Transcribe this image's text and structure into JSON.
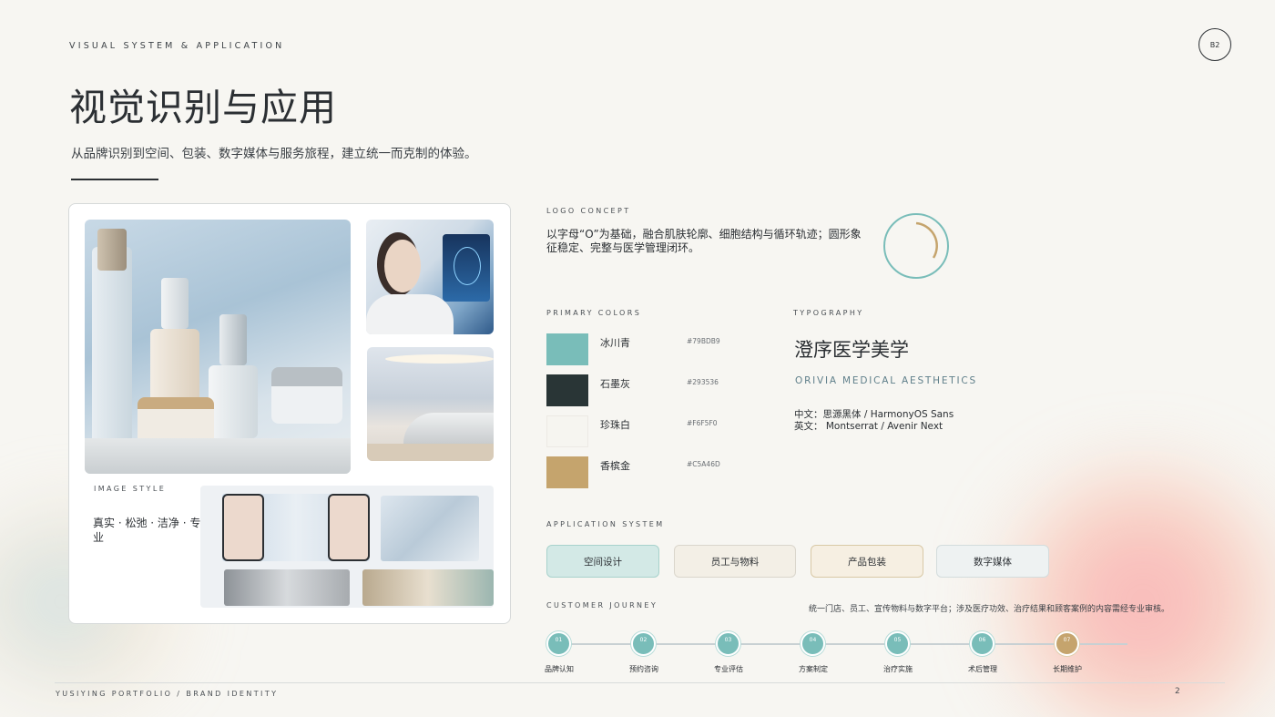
{
  "header": {
    "kicker": "VISUAL SYSTEM & APPLICATION",
    "badge": "B2",
    "title": "视觉识别与应用",
    "subtitle": "从品牌识别到空间、包装、数字媒体与服务旅程，建立统一而克制的体验。"
  },
  "image_panel": {
    "label": "IMAGE STYLE",
    "style_text": "真实 · 松弛 · 洁净 · 专业"
  },
  "logo_concept": {
    "label": "LOGO CONCEPT",
    "text": "以字母“O”为基础，融合肌肤轮廓、细胞结构与循环轨迹；圆形象征稳定、完整与医学管理闭环。",
    "ring_color": "#79BDB9",
    "arc_color": "#C5A46D"
  },
  "colors": {
    "label": "PRIMARY COLORS",
    "items": [
      {
        "name": "冰川青",
        "hex": "#79BDB9"
      },
      {
        "name": "石墨灰",
        "hex": "#293536"
      },
      {
        "name": "珍珠白",
        "hex": "#F6F5F0"
      },
      {
        "name": "香槟金",
        "hex": "#C5A46D"
      }
    ]
  },
  "typography": {
    "label": "TYPOGRAPHY",
    "cn_name": "澄序医学美学",
    "en_name": "ORIVIA MEDICAL AESTHETICS",
    "cn_font": "中文：思源黑体  / HarmonyOS Sans",
    "en_font": "英文：  Montserrat / Avenir Next"
  },
  "application": {
    "label": "APPLICATION SYSTEM",
    "buttons": [
      "空间设计",
      "员工与物料",
      "产品包装",
      "数字媒体"
    ]
  },
  "journey": {
    "label": "CUSTOMER JOURNEY",
    "note": "统一门店、员工、宣传物料与数字平台；涉及医疗功效、治疗结果和顾客案例的内容需经专业审核。",
    "steps": [
      {
        "num": "01",
        "label": "品牌认知"
      },
      {
        "num": "02",
        "label": "预约咨询"
      },
      {
        "num": "03",
        "label": "专业评估"
      },
      {
        "num": "04",
        "label": "方案制定"
      },
      {
        "num": "05",
        "label": "治疗实施"
      },
      {
        "num": "06",
        "label": "术后管理"
      },
      {
        "num": "07",
        "label": "长期维护"
      }
    ]
  },
  "footer": {
    "left": "YUSIYING PORTFOLIO / BRAND IDENTITY",
    "page": "2"
  }
}
